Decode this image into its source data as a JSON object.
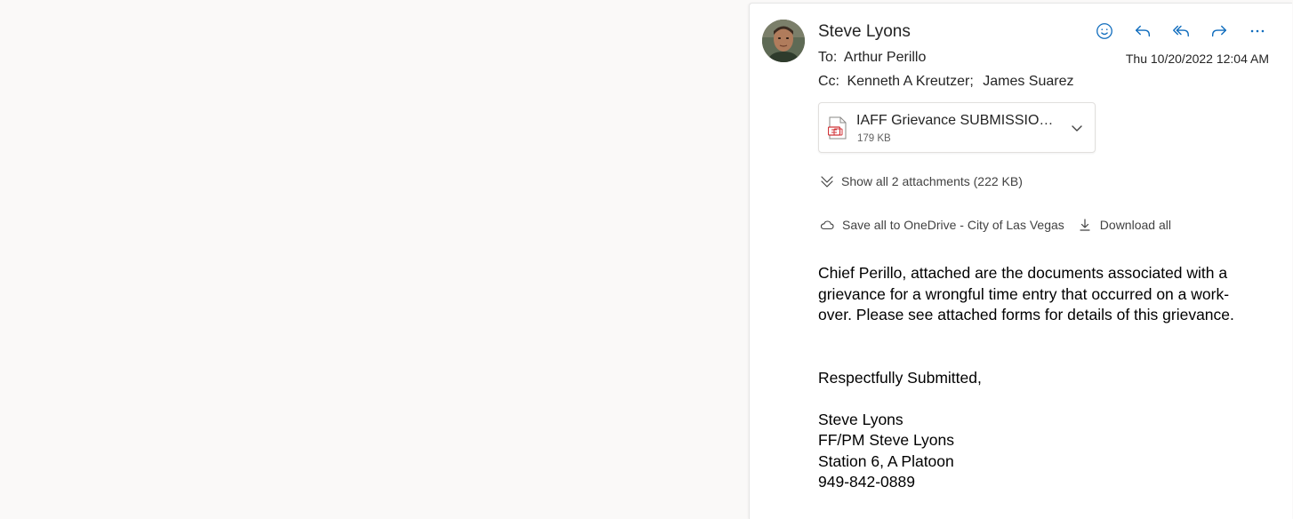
{
  "email": {
    "sender": "Steve Lyons",
    "to_label": "To:",
    "to": "Arthur Perillo",
    "cc_label": "Cc:",
    "cc": [
      "Kenneth A Kreutzer;",
      "James Suarez"
    ],
    "date": "Thu 10/20/2022 12:04 AM"
  },
  "actions": {
    "icons": [
      "smiley-icon",
      "reply-icon",
      "reply-all-icon",
      "forward-icon",
      "more-icon"
    ]
  },
  "attachment": {
    "name": "IAFF Grievance SUBMISSION ...",
    "size": "179 KB"
  },
  "show_all": "Show all 2 attachments (222 KB)",
  "attachment_actions": {
    "save_onedrive": "Save all to OneDrive - City of Las Vegas",
    "download_all": "Download all"
  },
  "body": {
    "paragraph": "Chief Perillo, attached are the documents associated with a grievance for a wrongful time entry that occurred on a work-over. Please see attached forms for details of this grievance.",
    "closing": "Respectfully Submitted,",
    "signature": [
      "Steve Lyons",
      "FF/PM Steve Lyons",
      "Station 6, A Platoon",
      "949-842-0889"
    ]
  },
  "colors": {
    "accent": "#0f6cbd",
    "pdf_red": "#d13438"
  }
}
